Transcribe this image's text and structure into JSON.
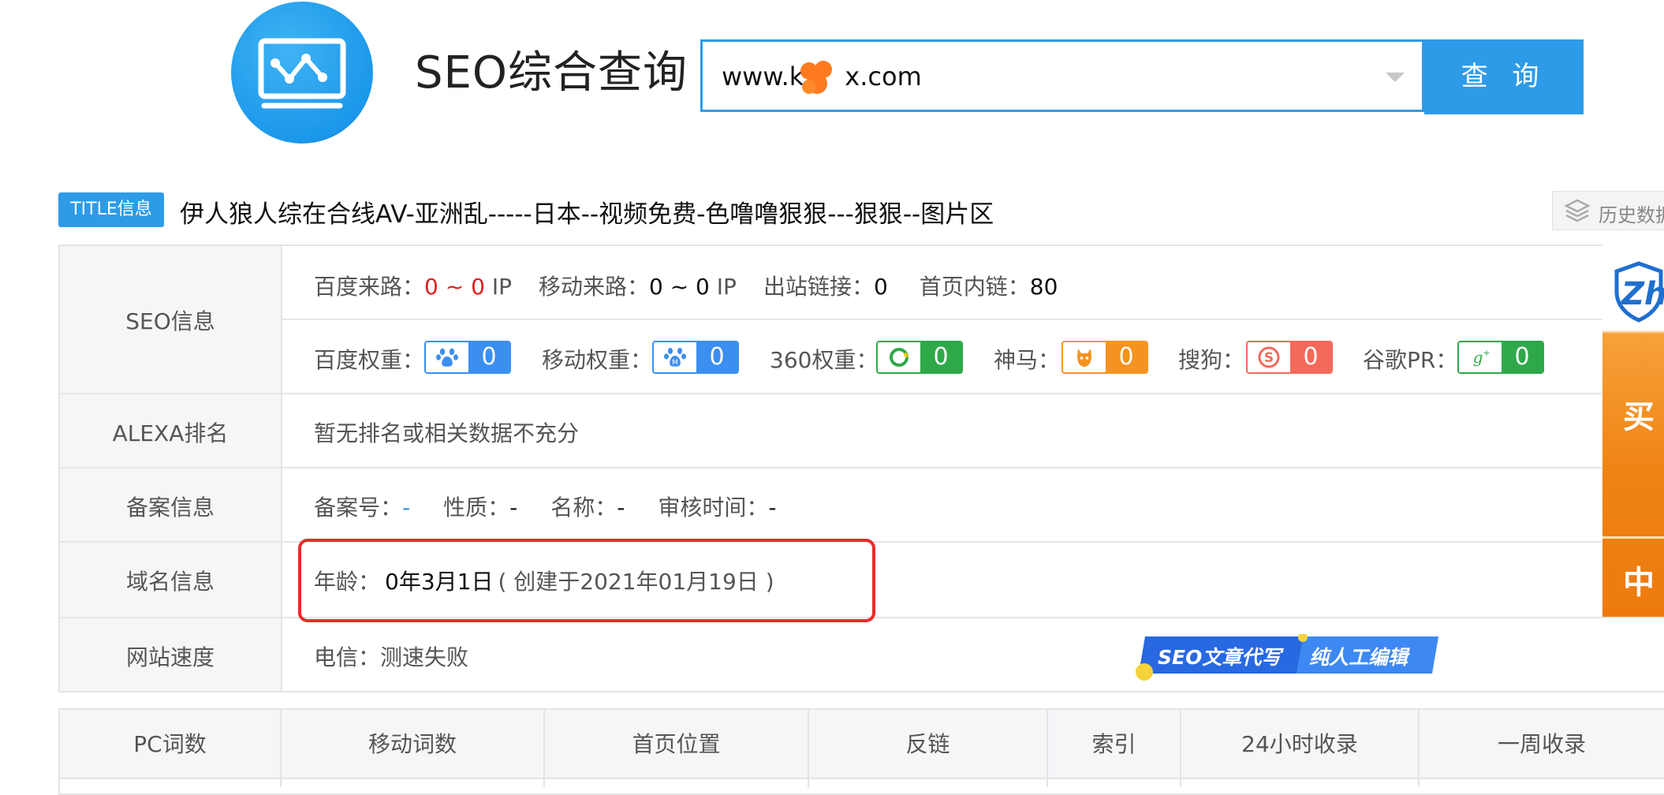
{
  "header": {
    "site_title": "SEO综合查询",
    "search_value": "www.k x.com",
    "search_value_visible_left": "www.k",
    "search_value_visible_right": "x.com",
    "query_button": "查 询"
  },
  "title_row": {
    "tag": "TITLE信息",
    "title_text": "伊人狼人综在合线AV-亚洲乱-----日本--视频免费-色噜噜狠狠---狠狠--图片区",
    "history_button": "历史数据"
  },
  "seo": {
    "label": "SEO信息",
    "traffic": {
      "baidu_label": "百度来路：",
      "baidu_value": "0 ~ 0",
      "baidu_unit": "IP",
      "mobile_label": "移动来路：",
      "mobile_value": "0 ~ 0",
      "mobile_unit": "IP",
      "outlinks_label": "出站链接：",
      "outlinks_value": "0",
      "internal_label": "首页内链：",
      "internal_value": "80"
    },
    "weights": [
      {
        "label": "百度权重：",
        "value": "0",
        "color": "#3b8ff0",
        "icon": "baidu-paw-icon"
      },
      {
        "label": "移动权重：",
        "value": "0",
        "color": "#3b8ff0",
        "icon": "mobile-paw-icon"
      },
      {
        "label": "360权重：",
        "value": "0",
        "color": "#2fa84a",
        "icon": "360-ring-icon"
      },
      {
        "label": "神马：",
        "value": "0",
        "color": "#f59321",
        "icon": "shenma-horse-icon"
      },
      {
        "label": "搜狗：",
        "value": "0",
        "color": "#f26a5a",
        "icon": "sogou-s-icon"
      },
      {
        "label": "谷歌PR：",
        "value": "0",
        "color": "#2fa84a",
        "icon": "google-plus-icon"
      }
    ]
  },
  "alexa": {
    "label": "ALEXA排名",
    "text": "暂无排名或相关数据不充分"
  },
  "icp": {
    "label": "备案信息",
    "number_label": "备案号：",
    "number_value": "-",
    "nature_label": "性质：",
    "nature_value": "-",
    "name_label": "名称：",
    "name_value": "-",
    "audit_label": "审核时间：",
    "audit_value": "-"
  },
  "domain": {
    "label": "域名信息",
    "age_label": "年龄：",
    "age_value": "0年3月1日",
    "created_text": "( 创建于2021年01月19日 )"
  },
  "speed": {
    "label": "网站速度",
    "telecom_label": "电信：",
    "telecom_value": "测速失败",
    "ad_left": "SEO文章代写",
    "ad_right": "纯人工编辑"
  },
  "side_ad": {
    "logo_text": "Zho",
    "char1": "买",
    "char2": "中"
  },
  "bottom_table": {
    "headers": [
      "PC词数",
      "移动词数",
      "首页位置",
      "反链",
      "索引",
      "24小时收录",
      "一周收录"
    ]
  },
  "colors": {
    "accent": "#2e9be8",
    "highlight_frame": "#ec2b2b",
    "alert_red": "#e02020"
  }
}
